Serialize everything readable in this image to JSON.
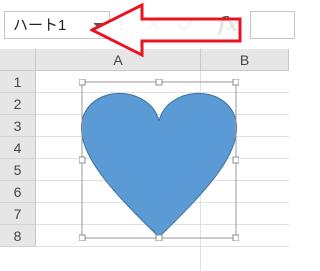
{
  "formula_bar": {
    "name_box_value": "ハート1",
    "fx_label": "fx",
    "formula_value": ""
  },
  "grid": {
    "columns": [
      "A",
      "B"
    ],
    "rows": [
      "1",
      "2",
      "3",
      "4",
      "5",
      "6",
      "7",
      "8"
    ]
  },
  "shape": {
    "type": "heart",
    "fill_color": "#5b9bd5",
    "stroke_color": "#41719c",
    "selected": true
  },
  "annotation": {
    "type": "arrow",
    "direction": "left",
    "outline_color": "#e8141f",
    "fill_color": "#ffffff"
  },
  "icons": {
    "name_box_dropdown": "chevron-down-icon",
    "cancel": "close-icon",
    "enter": "check-icon",
    "function": "fx-icon"
  }
}
